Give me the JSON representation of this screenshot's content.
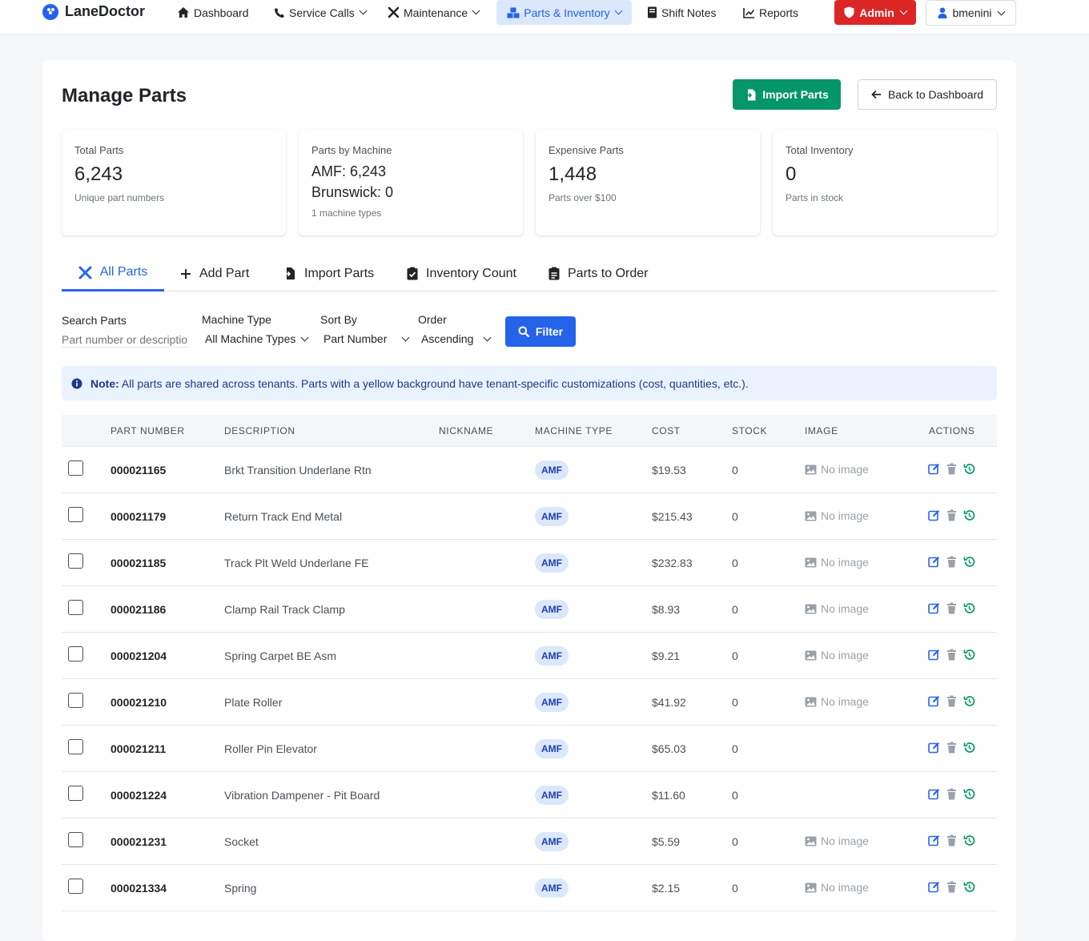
{
  "nav": {
    "brand": "LaneDoctor",
    "items": [
      {
        "label": "Dashboard"
      },
      {
        "label": "Service Calls"
      },
      {
        "label": "Maintenance"
      },
      {
        "label": "Parts & Inventory"
      },
      {
        "label": "Shift Notes"
      },
      {
        "label": "Reports"
      }
    ],
    "admin_label": "Admin",
    "user_label": "bmenini"
  },
  "colors": {
    "primary": "#2563eb",
    "success": "#059669",
    "danger": "#dc2626",
    "badge_bg": "#dbe7fb"
  },
  "page": {
    "title": "Manage Parts",
    "import_button": "Import Parts",
    "back_button": "Back to Dashboard"
  },
  "stats": {
    "total": {
      "label": "Total Parts",
      "value": "6,243",
      "sub": "Unique part numbers"
    },
    "by_machine": {
      "label": "Parts by Machine",
      "line1": "AMF: 6,243",
      "line2": "Brunswick: 0",
      "sub": "1 machine types"
    },
    "expensive": {
      "label": "Expensive Parts",
      "value": "1,448",
      "sub": "Parts over $100"
    },
    "inventory": {
      "label": "Total Inventory",
      "value": "0",
      "sub": "Parts in stock"
    }
  },
  "tabs": [
    {
      "label": "All Parts"
    },
    {
      "label": "Add Part"
    },
    {
      "label": "Import Parts"
    },
    {
      "label": "Inventory Count"
    },
    {
      "label": "Parts to Order"
    }
  ],
  "filters": {
    "search_label": "Search Parts",
    "search_placeholder": "Part number or descriptio",
    "machine_label": "Machine Type",
    "machine_value": "All Machine Types",
    "sort_label": "Sort By",
    "sort_value": "Part Number",
    "order_label": "Order",
    "order_value": "Ascending",
    "filter_button": "Filter"
  },
  "note": {
    "bold": "Note:",
    "text": "All parts are shared across tenants. Parts with a yellow background have tenant-specific customizations (cost, quantities, etc.)."
  },
  "table": {
    "headers": {
      "part_number": "PART NUMBER",
      "description": "DESCRIPTION",
      "nickname": "NICKNAME",
      "machine_type": "MACHINE TYPE",
      "cost": "COST",
      "stock": "STOCK",
      "image": "IMAGE",
      "actions": "ACTIONS"
    },
    "no_image_label": "No image",
    "rows": [
      {
        "part_number": "000021165",
        "description": "Brkt Transition Underlane Rtn",
        "nickname": "",
        "machine": "AMF",
        "cost": "$19.53",
        "stock": "0",
        "image": "No image"
      },
      {
        "part_number": "000021179",
        "description": "Return Track End Metal",
        "nickname": "",
        "machine": "AMF",
        "cost": "$215.43",
        "stock": "0",
        "image": "No image"
      },
      {
        "part_number": "000021185",
        "description": "Track Plt Weld Underlane FE",
        "nickname": "",
        "machine": "AMF",
        "cost": "$232.83",
        "stock": "0",
        "image": "No image"
      },
      {
        "part_number": "000021186",
        "description": "Clamp Rail Track Clamp",
        "nickname": "",
        "machine": "AMF",
        "cost": "$8.93",
        "stock": "0",
        "image": "No image"
      },
      {
        "part_number": "000021204",
        "description": "Spring Carpet BE Asm",
        "nickname": "",
        "machine": "AMF",
        "cost": "$9.21",
        "stock": "0",
        "image": "No image"
      },
      {
        "part_number": "000021210",
        "description": "Plate Roller",
        "nickname": "",
        "machine": "AMF",
        "cost": "$41.92",
        "stock": "0",
        "image": "No image"
      },
      {
        "part_number": "000021211",
        "description": "Roller Pin Elevator",
        "nickname": "",
        "machine": "AMF",
        "cost": "$65.03",
        "stock": "0",
        "image": ""
      },
      {
        "part_number": "000021224",
        "description": "Vibration Dampener - Pit Board",
        "nickname": "",
        "machine": "AMF",
        "cost": "$11.60",
        "stock": "0",
        "image": ""
      },
      {
        "part_number": "000021231",
        "description": "Socket",
        "nickname": "",
        "machine": "AMF",
        "cost": "$5.59",
        "stock": "0",
        "image": "No image"
      },
      {
        "part_number": "000021334",
        "description": "Spring",
        "nickname": "",
        "machine": "AMF",
        "cost": "$2.15",
        "stock": "0",
        "image": "No image"
      }
    ]
  }
}
